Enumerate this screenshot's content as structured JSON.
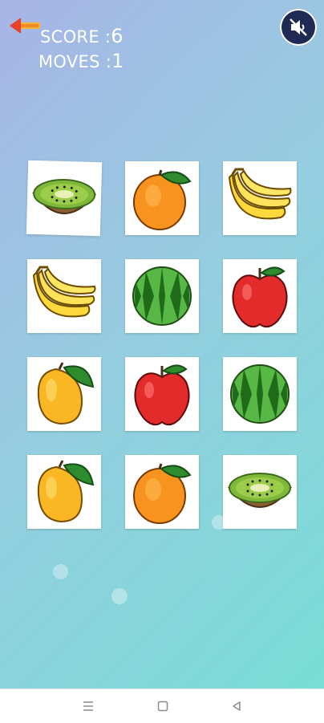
{
  "header": {
    "score_label": "SCORE :",
    "score_value": "6",
    "moves_label": "MOVES :",
    "moves_value": "1",
    "back_icon": "back-arrow-icon",
    "sound_icon": "sound-muted-icon"
  },
  "board": {
    "rows": 4,
    "cols": 3,
    "cards": [
      {
        "fruit": "kiwi"
      },
      {
        "fruit": "orange"
      },
      {
        "fruit": "banana"
      },
      {
        "fruit": "banana"
      },
      {
        "fruit": "watermelon"
      },
      {
        "fruit": "apple"
      },
      {
        "fruit": "mango"
      },
      {
        "fruit": "apple"
      },
      {
        "fruit": "watermelon"
      },
      {
        "fruit": "mango"
      },
      {
        "fruit": "orange"
      },
      {
        "fruit": "kiwi"
      }
    ]
  },
  "navbar": {
    "icons": [
      "menu-icon",
      "home-square-icon",
      "back-triangle-icon"
    ]
  },
  "colors": {
    "background_start": "#a7b4e6",
    "background_end": "#79ddd6",
    "sound_button": "#1f2a55",
    "back_arrow": "#e8412a"
  }
}
